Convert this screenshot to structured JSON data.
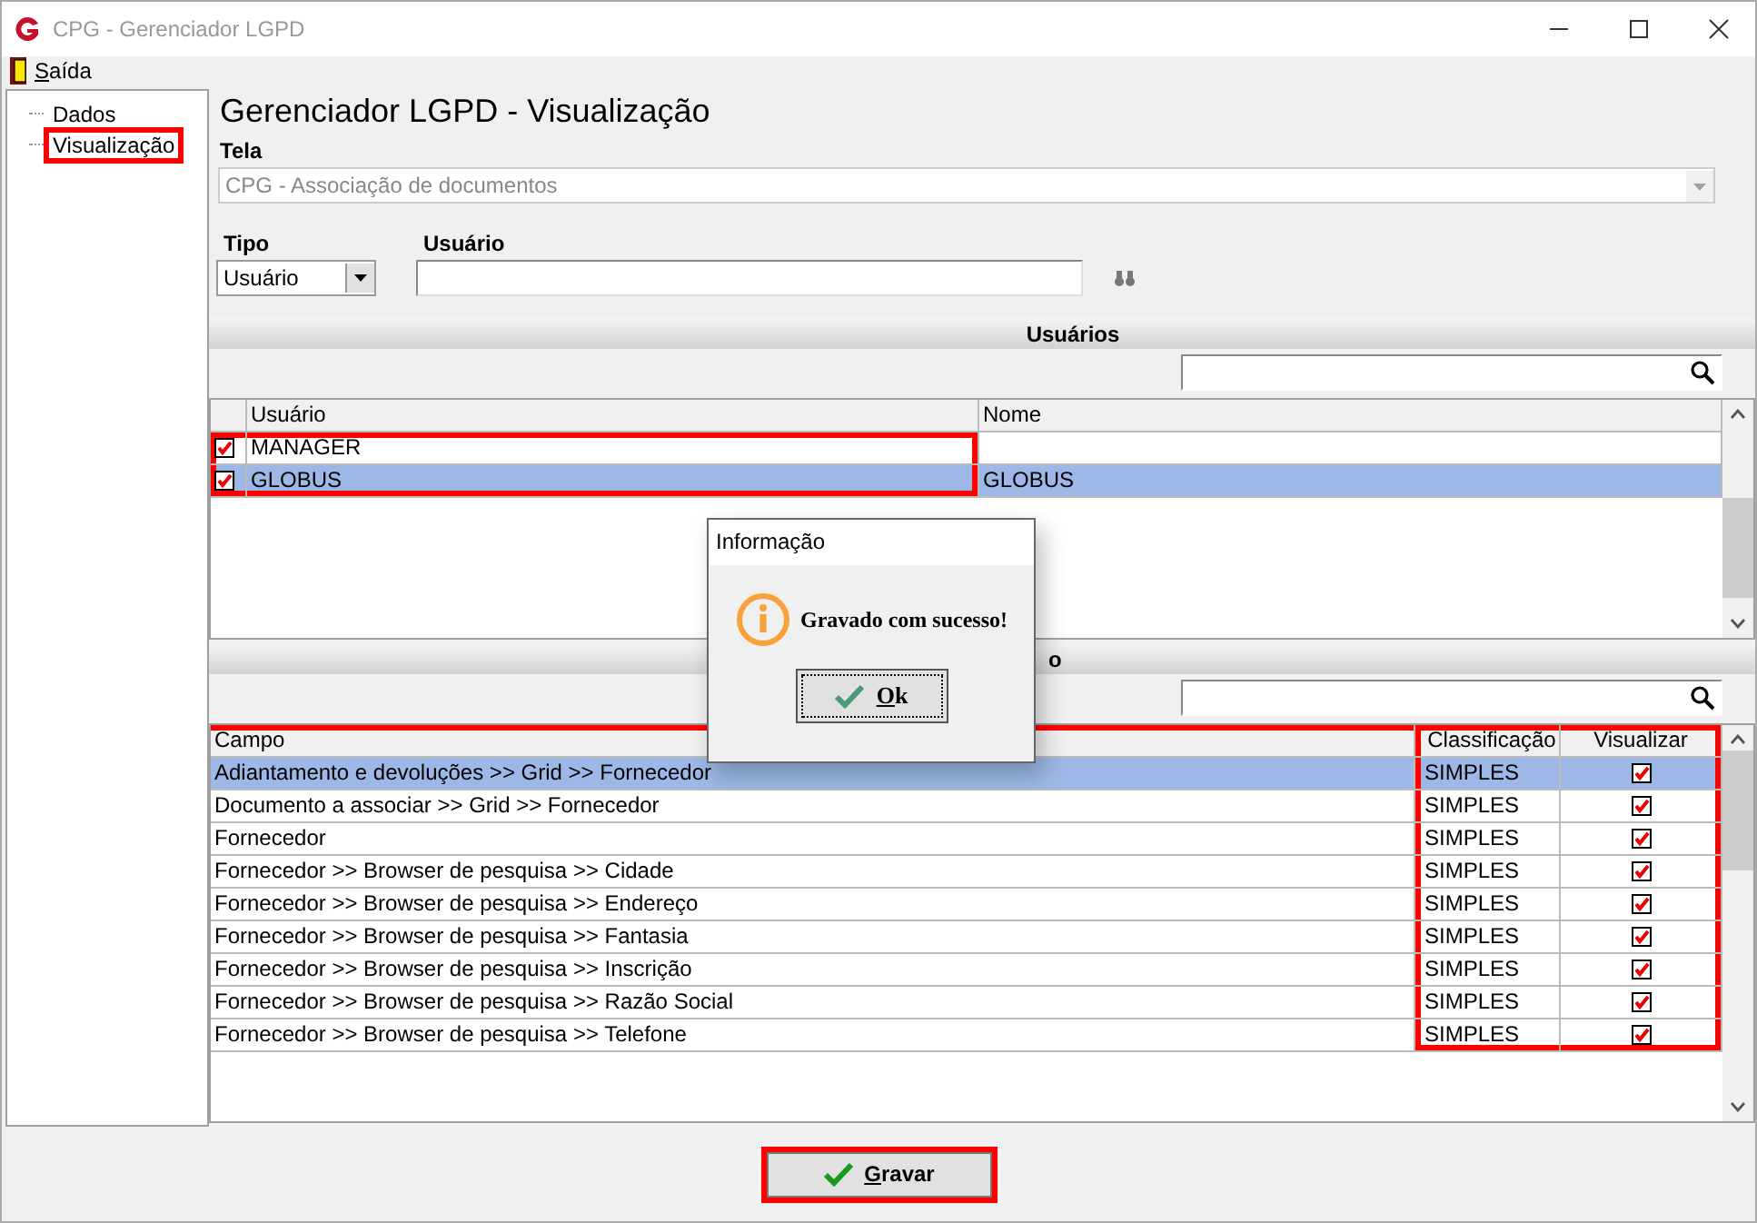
{
  "window": {
    "title": "CPG - Gerenciador LGPD"
  },
  "menu": [
    {
      "label": "Saída"
    }
  ],
  "sidebar": {
    "items": [
      {
        "label": "Dados",
        "highlighted": false
      },
      {
        "label": "Visualização",
        "highlighted": true
      }
    ]
  },
  "heading": "Gerenciador LGPD - Visualização",
  "tela": {
    "label": "Tela",
    "value": "CPG - Associação de documentos",
    "disabled": true
  },
  "tipo": {
    "label": "Tipo",
    "value": "Usuário"
  },
  "usuario": {
    "label": "Usuário"
  },
  "users_section": {
    "title": "Usuários",
    "columns": [
      "Usuário",
      "Nome"
    ],
    "highlighted": true,
    "rows": [
      {
        "checked": true,
        "selected": false,
        "user": "MANAGER"
      },
      {
        "checked": true,
        "selected": true,
        "user": "GLOBUS",
        "name": "GLOBUS"
      }
    ]
  },
  "fields_section": {
    "title": "o",
    "columns": [
      "Campo",
      "Classificação",
      "Visualizar"
    ],
    "highlighted": true,
    "rows": [
      {
        "campo": "Adiantamento e devoluções >> Grid >> Fornecedor",
        "classificacao": "SIMPLES",
        "visualizar": true,
        "selected": true
      },
      {
        "campo": "Documento a associar >> Grid >> Fornecedor",
        "classificacao": "SIMPLES",
        "visualizar": true,
        "selected": false
      },
      {
        "campo": "Fornecedor",
        "classificacao": "SIMPLES",
        "visualizar": true,
        "selected": false
      },
      {
        "campo": "Fornecedor >> Browser de pesquisa >> Cidade",
        "classificacao": "SIMPLES",
        "visualizar": true,
        "selected": false
      },
      {
        "campo": "Fornecedor >> Browser de pesquisa >> Endereço",
        "classificacao": "SIMPLES",
        "visualizar": true,
        "selected": false
      },
      {
        "campo": "Fornecedor >> Browser de pesquisa >> Fantasia",
        "classificacao": "SIMPLES",
        "visualizar": true,
        "selected": false
      },
      {
        "campo": "Fornecedor >> Browser de pesquisa >> Inscrição",
        "classificacao": "SIMPLES",
        "visualizar": true,
        "selected": false
      },
      {
        "campo": "Fornecedor >> Browser de pesquisa >> Razão Social",
        "classificacao": "SIMPLES",
        "visualizar": true,
        "selected": false
      },
      {
        "campo": "Fornecedor >> Browser de pesquisa >> Telefone",
        "classificacao": "SIMPLES",
        "visualizar": true,
        "selected": false
      }
    ]
  },
  "dialog": {
    "title": "Informação",
    "message": "Gravado com sucesso!",
    "button": {
      "label": "Ok"
    }
  },
  "save_button": {
    "label": "Gravar",
    "highlighted": true
  }
}
